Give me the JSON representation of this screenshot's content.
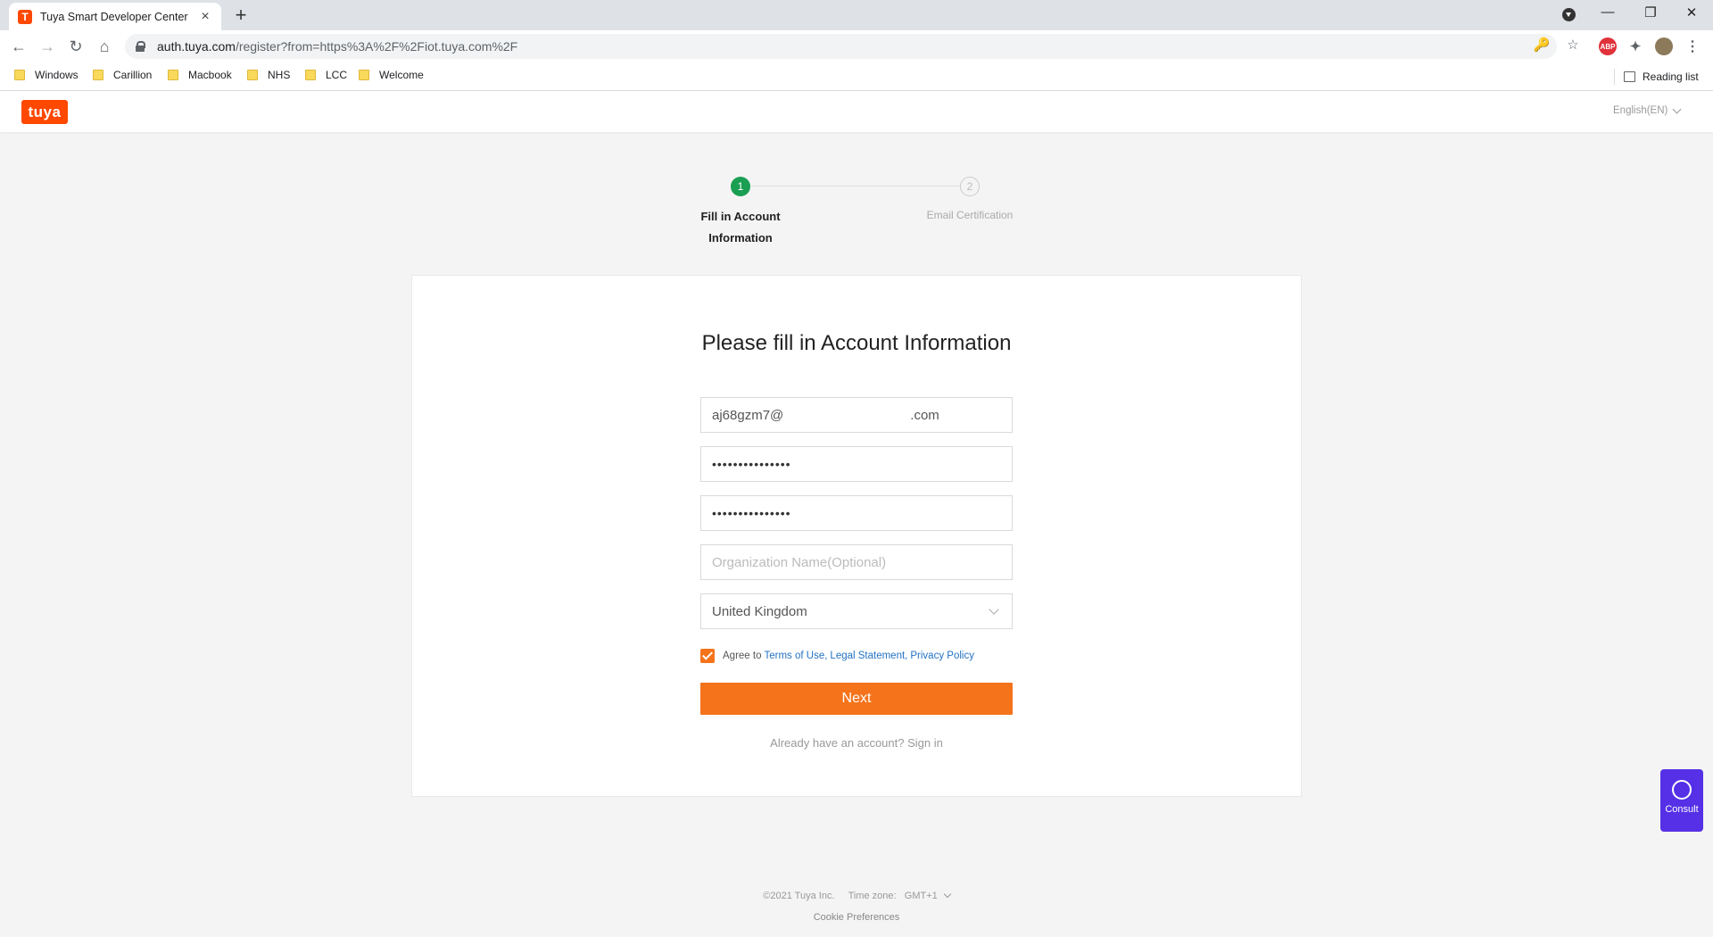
{
  "browser": {
    "tab_title": "Tuya Smart Developer Center",
    "tab_favicon": "T",
    "new_tab": "+",
    "url_host": "auth.tuya.com",
    "url_path": "/register?from=https%3A%2F%2Fiot.tuya.com%2F",
    "window_controls": {
      "minimize": "—",
      "restore": "❐",
      "close": "✕"
    },
    "nav": {
      "back": "←",
      "forward": "→",
      "reload": "↻",
      "home": "⌂"
    },
    "omnibox_icons": {
      "key": "🔑",
      "star": "☆"
    },
    "extensions": {
      "adblock": "ABP",
      "puzzle": "✦",
      "menu": "⋮"
    },
    "bookmarks": [
      "Windows",
      "Carillion",
      "Macbook",
      "NHS",
      "LCC",
      "Welcome"
    ],
    "reading_list": "Reading list"
  },
  "header": {
    "logo_text": "tuya",
    "language": "English(EN)"
  },
  "steps": [
    {
      "number": "1",
      "label": "Fill in Account Information",
      "active": true
    },
    {
      "number": "2",
      "label": "Email Certification",
      "active": false
    }
  ],
  "form": {
    "title": "Please fill in Account Information",
    "email_local": "aj68gzm7@",
    "email_suffix": ".com",
    "password_mask": "•••••••••••••••",
    "confirm_password_mask": "•••••••••••••••",
    "organization_placeholder": "Organization Name(Optional)",
    "country_value": "United Kingdom",
    "agree_prefix": "Agree to",
    "agree_checked": true,
    "terms_link": "Terms of Use,",
    "legal_link": "Legal Statement,",
    "privacy_link": "Privacy Policy",
    "next_button": "Next",
    "signin_text": "Already have an account? Sign in"
  },
  "consult": {
    "label": "Consult"
  },
  "footer": {
    "copyright": "©2021 Tuya Inc.",
    "timezone_label": "Time zone:",
    "timezone_value": "GMT+1",
    "cookie": "Cookie Preferences"
  },
  "colors": {
    "brand": "#ff4800",
    "accent": "#f5731b",
    "step_active": "#1a9e52",
    "link": "#2372c4",
    "consult": "#5530e6"
  }
}
